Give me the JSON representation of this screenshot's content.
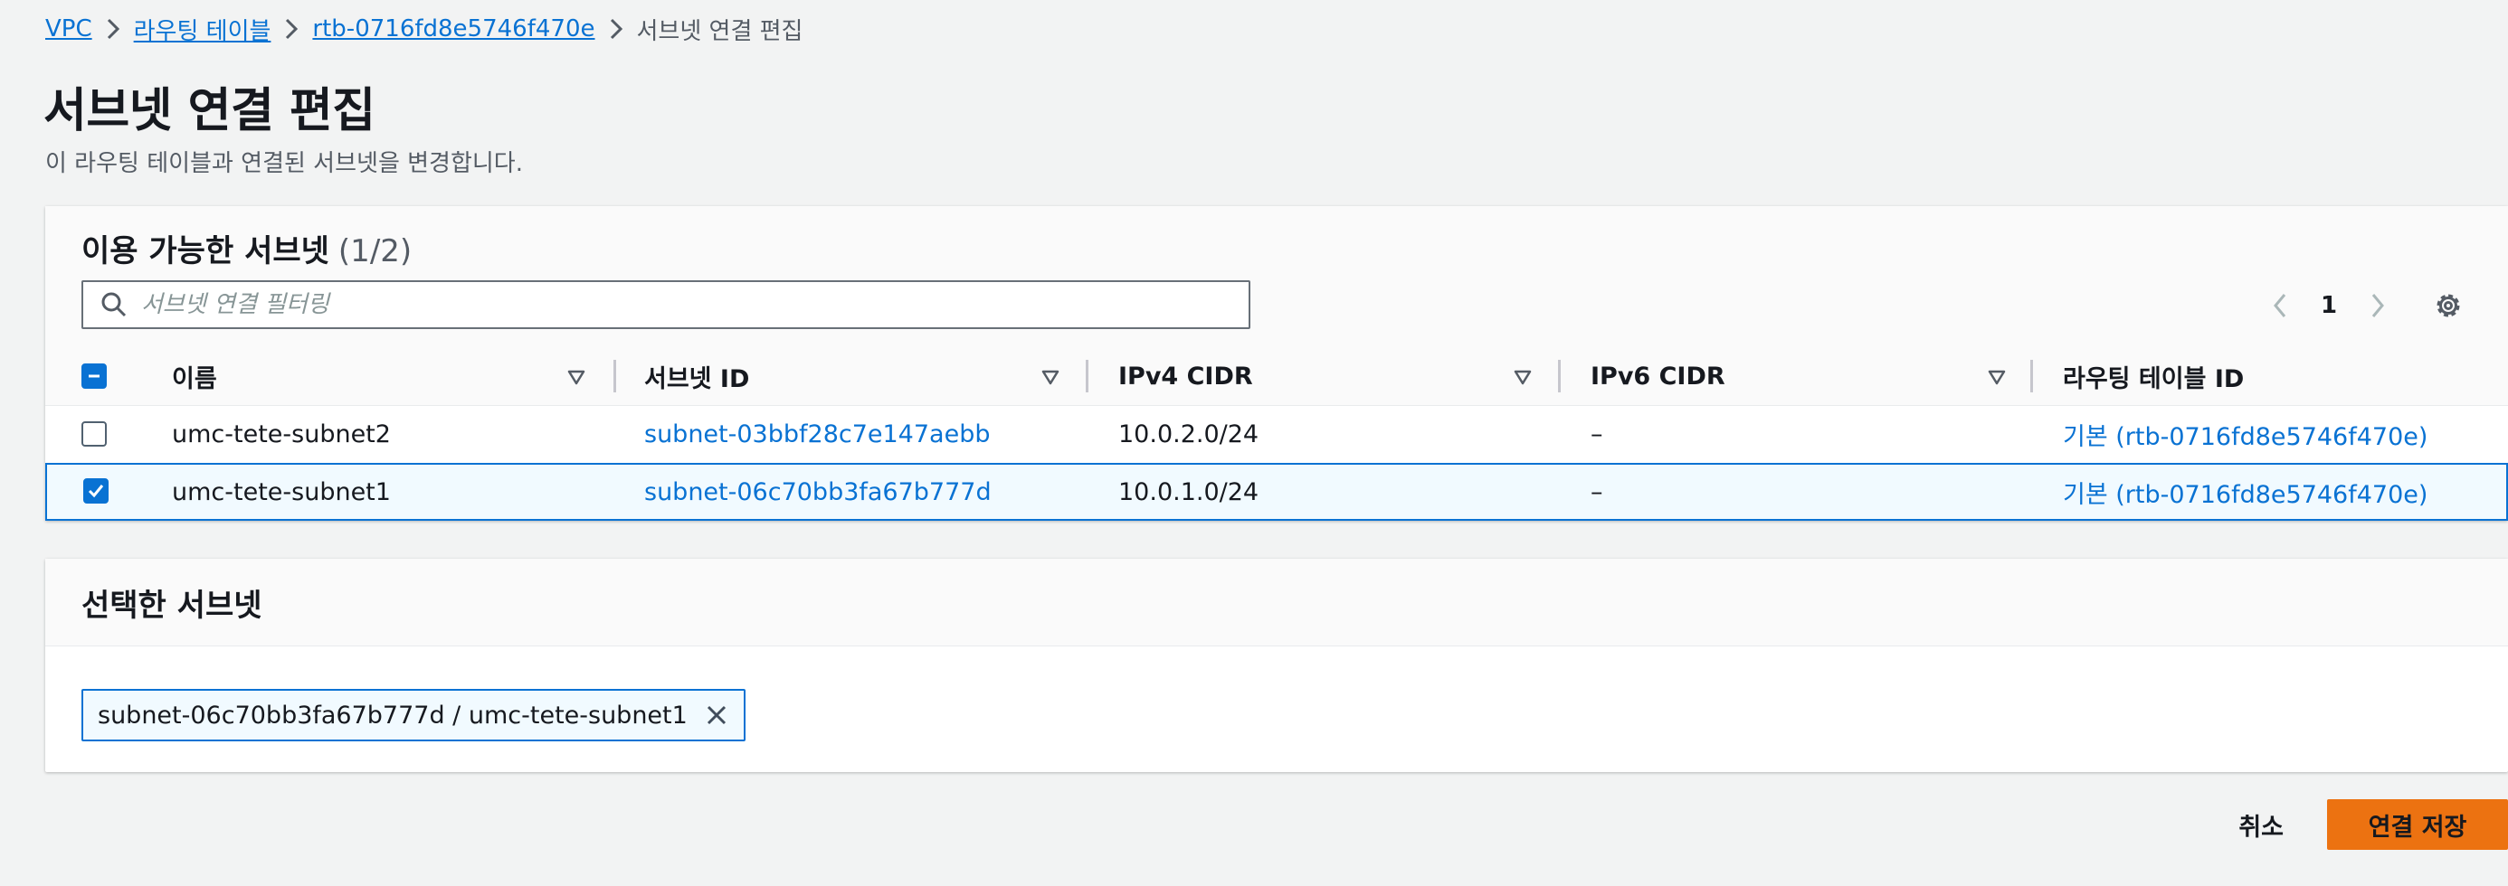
{
  "breadcrumb": {
    "items": [
      "VPC",
      "라우팅 테이블",
      "rtb-0716fd8e5746f470e"
    ],
    "current": "서브넷 연결 편집"
  },
  "header": {
    "title": "서브넷 연결 편집",
    "description": "이 라우팅 테이블과 연결된 서브넷을 변경합니다."
  },
  "available": {
    "title": "이용 가능한 서브넷",
    "count": "(1/2)",
    "filter_placeholder": "서브넷 연결 필터링",
    "page": "1",
    "columns": [
      "이름",
      "서브넷 ID",
      "IPv4 CIDR",
      "IPv6 CIDR",
      "라우팅 테이블 ID"
    ],
    "rows": [
      {
        "name": "umc-tete-subnet2",
        "subnet_id": "subnet-03bbf28c7e147aebb",
        "ipv4": "10.0.2.0/24",
        "ipv6": "–",
        "route_table": "기본 (rtb-0716fd8e5746f470e)",
        "checked": false
      },
      {
        "name": "umc-tete-subnet1",
        "subnet_id": "subnet-06c70bb3fa67b777d",
        "ipv4": "10.0.1.0/24",
        "ipv6": "–",
        "route_table": "기본 (rtb-0716fd8e5746f470e)",
        "checked": true
      }
    ]
  },
  "selected": {
    "title": "선택한 서브넷",
    "tokens": [
      "subnet-06c70bb3fa67b777d / umc-tete-subnet1"
    ]
  },
  "actions": {
    "cancel": "취소",
    "save": "연결 저장"
  },
  "colors": {
    "link": "#0972d3",
    "primary_button": "#ec7211",
    "page_bg": "#f2f3f3"
  },
  "icons": [
    "chevron-right-icon",
    "search-icon",
    "chevron-left-icon",
    "gear-icon",
    "sort-caret-icon",
    "check-icon",
    "minus-icon",
    "close-icon"
  ]
}
